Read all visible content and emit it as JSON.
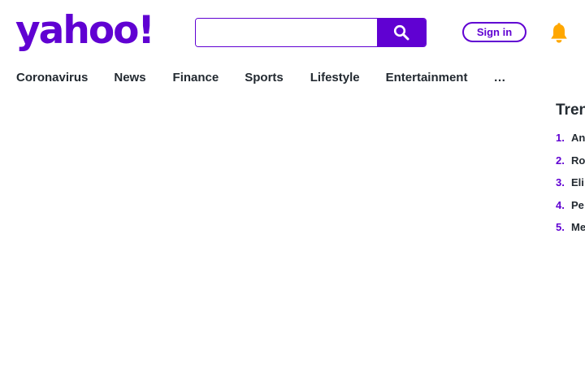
{
  "header": {
    "logo_text": "yahoo!",
    "search": {
      "value": "",
      "placeholder": ""
    },
    "signin_label": "Sign in"
  },
  "nav": {
    "items": [
      "Coronavirus",
      "News",
      "Finance",
      "Sports",
      "Lifestyle",
      "Entertainment"
    ],
    "more_label": "…"
  },
  "trending": {
    "title": "Tren",
    "items": [
      {
        "number": "1.",
        "text": "An"
      },
      {
        "number": "2.",
        "text": "Ro"
      },
      {
        "number": "3.",
        "text": "Eli"
      },
      {
        "number": "4.",
        "text": "Pe"
      },
      {
        "number": "5.",
        "text": "Me"
      }
    ]
  },
  "colors": {
    "brand": "#6001d2",
    "text": "#232a31",
    "bell": "#ffa700"
  },
  "icons": [
    "search-icon",
    "bell-icon"
  ]
}
